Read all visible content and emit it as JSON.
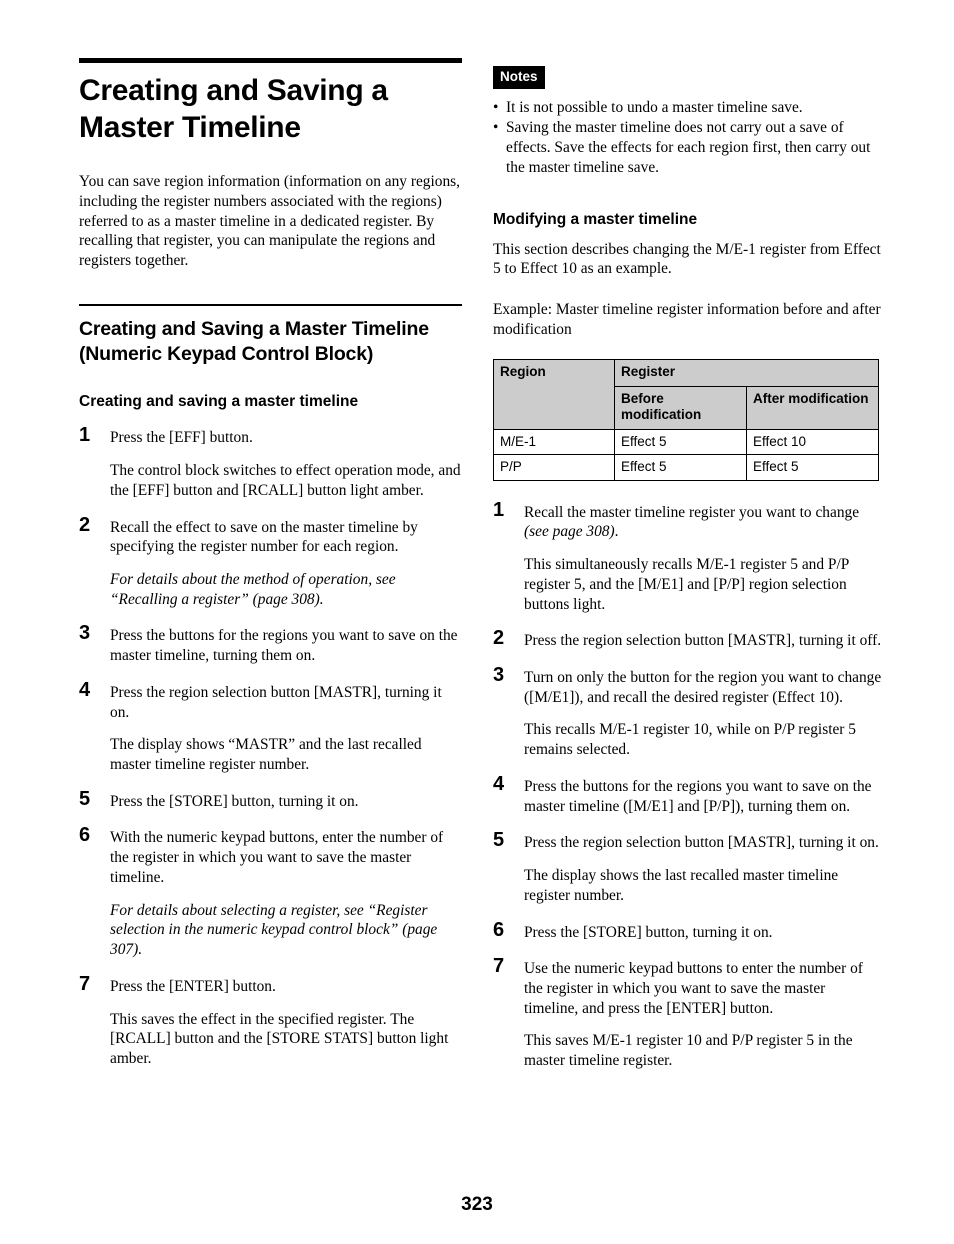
{
  "page": {
    "number": "323"
  },
  "left_column": {
    "title": "Creating and Saving a Master Timeline",
    "intro": "You can save region information (information on any regions, including the register numbers associated with the regions) referred to as a master timeline in a dedicated register. By recalling that register, you can manipulate the regions and registers together.",
    "section_title": "Creating and Saving a Master Timeline (Numeric Keypad Control Block)",
    "subsection_title": "Creating and saving a master timeline",
    "steps": [
      {
        "num": "1",
        "text": "Press the [EFF] button.",
        "detail": "The control block switches to effect operation mode, and the [EFF] button and [RCALL] button light amber."
      },
      {
        "num": "2",
        "text": "Recall the effect to save on the master timeline by specifying the register number for each region.",
        "detail_italic": "For details about the method of operation, see “Recalling a register” (page 308)."
      },
      {
        "num": "3",
        "text": "Press the buttons for the regions you want to save on the master timeline, turning them on."
      },
      {
        "num": "4",
        "text": "Press the region selection button [MASTR], turning it on.",
        "detail": "The display shows “MASTR” and the last recalled master timeline register number."
      },
      {
        "num": "5",
        "text": "Press the [STORE] button, turning it on."
      },
      {
        "num": "6",
        "text": "With the numeric keypad buttons, enter the number of the register in which you want to save the master timeline.",
        "detail_italic": "For details about selecting a register, see “Register selection in the numeric keypad control block” (page 307)."
      },
      {
        "num": "7",
        "text": "Press the [ENTER] button.",
        "detail": "This saves the effect in the specified register. The [RCALL] button and the [STORE STATS] button light amber."
      }
    ]
  },
  "right_column": {
    "notes": {
      "label": "Notes",
      "items": [
        "It is not possible to undo a master timeline save.",
        "Saving the master timeline does not carry out a save of effects. Save the effects for each region first, then carry out the master timeline save."
      ]
    },
    "subsection_title": "Modifying a master timeline",
    "intro": "This section describes changing the M/E-1 register from Effect 5 to Effect 10 as an example.",
    "example_caption": "Example: Master timeline register information before and after modification",
    "table": {
      "header_region": "Region",
      "header_register": "Register",
      "header_before": "Before modification",
      "header_after": "After modification",
      "rows": [
        {
          "region": "M/E-1",
          "before": "Effect 5",
          "after": "Effect 10"
        },
        {
          "region": "P/P",
          "before": "Effect 5",
          "after": "Effect 5"
        }
      ]
    },
    "steps": [
      {
        "num": "1",
        "text": "Recall the master timeline register you want to change ",
        "text_italic": "(see page 308)",
        "text_tail": ".",
        "detail": "This simultaneously recalls M/E-1 register 5 and P/P register 5, and the [M/E1] and [P/P] region selection buttons light."
      },
      {
        "num": "2",
        "text": "Press the region selection button [MASTR], turning it off."
      },
      {
        "num": "3",
        "text": "Turn on only the button for the region you want to change ([M/E1]), and recall the desired register (Effect 10).",
        "detail": "This recalls M/E-1 register 10, while on P/P register 5 remains selected."
      },
      {
        "num": "4",
        "text": "Press the buttons for the regions you want to save on the master timeline ([M/E1] and [P/P]), turning them on."
      },
      {
        "num": "5",
        "text": "Press the region selection button [MASTR], turning it on.",
        "detail": "The display shows the last recalled master timeline register number."
      },
      {
        "num": "6",
        "text": "Press the [STORE] button, turning it on."
      },
      {
        "num": "7",
        "text": "Use the numeric keypad buttons to enter the number of the register in which you want to save the master timeline, and press the [ENTER] button.",
        "detail": "This saves M/E-1 register 10 and P/P register 5 in the master timeline register."
      }
    ]
  }
}
